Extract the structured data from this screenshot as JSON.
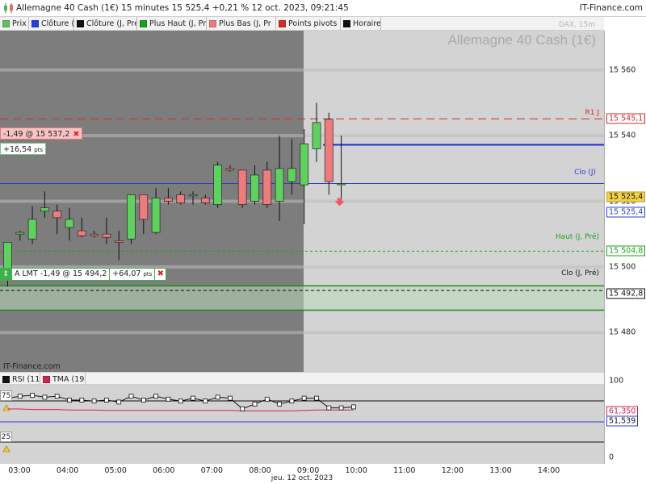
{
  "header": {
    "title": "Allemagne 40 Cash (1€) 15 minutes 15 525,4 +0,21 % 12 oct. 2023, 09:21:45",
    "brand": "IT-Finance.com"
  },
  "legend": {
    "items": [
      {
        "label": "Prix",
        "color": "#5fc15f"
      },
      {
        "label": "Clôture (J",
        "color": "#2b3ed8"
      },
      {
        "label": "Clôture (J, Pré",
        "color": "#111111"
      },
      {
        "label": "Plus Haut (J, Pr",
        "color": "#1aa31a"
      },
      {
        "label": "Plus Bas (J, Pr",
        "color": "#ef7c7c"
      },
      {
        "label": "Points pivots (",
        "color": "#d12b2b"
      },
      {
        "label": "Horaires",
        "color": "#111111"
      }
    ]
  },
  "watermark": {
    "instrument": "Allemagne 40 Cash (1€)",
    "sub": "DAX, 15m"
  },
  "position": {
    "label": "-1,49 @ 15 537,2",
    "pnl_value": "+16,54",
    "pnl_unit": "pts",
    "close": "✖"
  },
  "order": {
    "handle": "⇕",
    "label": "A LMT -1,49 @ 15 494,2",
    "pnl_value": "+64,07",
    "pnl_unit": "pts",
    "close": "✖"
  },
  "level_labels": {
    "r1": "R1 J",
    "clo": "Clo (J)",
    "haut": "Haut (J, Pré)",
    "clo_pre": "Clo (J, Pré)"
  },
  "site_label": "IT-Finance.com",
  "indicator_legend": {
    "items": [
      {
        "label": "RSI (11",
        "color": "#111111"
      },
      {
        "label": "TMA (19)",
        "color": "#d0244a"
      }
    ]
  },
  "indicator": {
    "upper_level": "75",
    "lower_level": "25",
    "rsi_last": "51,539",
    "tma_last": "61,350"
  },
  "y_axis_main": {
    "ticks": [
      "15 560",
      "15 540",
      "15 520",
      "15 500",
      "15 480"
    ],
    "labels": {
      "r1": "15 545,1",
      "last": "15 525,4",
      "clo": "15 525,4",
      "haut": "15 504,8",
      "clo_pre": "15 492,8"
    },
    "colors": {
      "r1": "#d12b2b",
      "last": "#f4d34a",
      "clo": "#2b3ed8",
      "haut": "#1aa31a",
      "clo_pre": "#111111"
    }
  },
  "y_axis_ind": {
    "ticks": [
      "100",
      "0"
    ]
  },
  "x_axis": {
    "ticks": [
      "03:00",
      "04:00",
      "05:00",
      "06:00",
      "07:00",
      "08:00",
      "09:00",
      "10:00",
      "11:00",
      "12:00",
      "13:00",
      "14:00"
    ],
    "date": "jeu. 12 oct. 2023"
  },
  "chart_data": {
    "type": "candlestick",
    "interval": "15 minutes",
    "y_range": [
      15468,
      15572
    ],
    "candles": [
      {
        "t": "02:45",
        "o": 15496.0,
        "h": 15507.0,
        "l": 15494.0,
        "c": 15507.5
      },
      {
        "t": "03:00",
        "o": 15510.0,
        "h": 15511.0,
        "l": 15508.0,
        "c": 15510.5
      },
      {
        "t": "03:15",
        "o": 15508.5,
        "h": 15518.5,
        "l": 15507.0,
        "c": 15514.5
      },
      {
        "t": "03:30",
        "o": 15517.0,
        "h": 15523.0,
        "l": 15515.0,
        "c": 15518.0
      },
      {
        "t": "03:45",
        "o": 15517.0,
        "h": 15519.0,
        "l": 15510.0,
        "c": 15515.0
      },
      {
        "t": "04:00",
        "o": 15512.0,
        "h": 15518.0,
        "l": 15508.0,
        "c": 15514.5
      },
      {
        "t": "04:15",
        "o": 15511.0,
        "h": 15515.0,
        "l": 15509.0,
        "c": 15509.5
      },
      {
        "t": "04:30",
        "o": 15510.0,
        "h": 15511.0,
        "l": 15509.0,
        "c": 15509.5
      },
      {
        "t": "04:45",
        "o": 15510.0,
        "h": 15515.0,
        "l": 15507.0,
        "c": 15509.0
      },
      {
        "t": "05:00",
        "o": 15508.0,
        "h": 15511.0,
        "l": 15502.0,
        "c": 15507.5
      },
      {
        "t": "05:15",
        "o": 15508.5,
        "h": 15522.0,
        "l": 15507.0,
        "c": 15522.0
      },
      {
        "t": "05:30",
        "o": 15522.0,
        "h": 15522.0,
        "l": 15510.0,
        "c": 15514.5
      },
      {
        "t": "05:45",
        "o": 15510.5,
        "h": 15524.0,
        "l": 15510.0,
        "c": 15521.0
      },
      {
        "t": "06:00",
        "o": 15521.0,
        "h": 15524.0,
        "l": 15519.0,
        "c": 15520.0
      },
      {
        "t": "06:15",
        "o": 15522.0,
        "h": 15523.0,
        "l": 15519.0,
        "c": 15519.5
      },
      {
        "t": "06:30",
        "o": 15522.0,
        "h": 15523.0,
        "l": 15519.0,
        "c": 15522.0
      },
      {
        "t": "06:45",
        "o": 15521.0,
        "h": 15522.0,
        "l": 15519.0,
        "c": 15519.5
      },
      {
        "t": "07:00",
        "o": 15519.0,
        "h": 15532.0,
        "l": 15518.0,
        "c": 15531.0
      },
      {
        "t": "07:15",
        "o": 15530.0,
        "h": 15531.0,
        "l": 15529.0,
        "c": 15529.5
      },
      {
        "t": "07:30",
        "o": 15529.5,
        "h": 15529.5,
        "l": 15518.0,
        "c": 15519.0
      },
      {
        "t": "07:45",
        "o": 15520.0,
        "h": 15531.0,
        "l": 15519.0,
        "c": 15528.0
      },
      {
        "t": "08:00",
        "o": 15529.5,
        "h": 15532.0,
        "l": 15518.0,
        "c": 15519.0
      },
      {
        "t": "08:15",
        "o": 15520.0,
        "h": 15540.0,
        "l": 15514.0,
        "c": 15530.0
      },
      {
        "t": "08:30",
        "o": 15526.0,
        "h": 15539.0,
        "l": 15522.0,
        "c": 15530.0
      },
      {
        "t": "08:45",
        "o": 15525.0,
        "h": 15542.0,
        "l": 15513.0,
        "c": 15537.5
      },
      {
        "t": "09:00",
        "o": 15536.0,
        "h": 15550.0,
        "l": 15532.0,
        "c": 15544.0
      },
      {
        "t": "09:15",
        "o": 15545.0,
        "h": 15547.0,
        "l": 15522.0,
        "c": 15526.0
      },
      {
        "t": "09:30",
        "o": 15525.4,
        "h": 15540.0,
        "l": 15520.5,
        "c": 15525.4
      }
    ],
    "levels": {
      "r1": 15545.1,
      "current": 15537.2,
      "clo": 15525.4,
      "haut_pre": 15504.8,
      "clo_pre": 15492.8,
      "order": 15494.2
    },
    "rsi": [
      59,
      61,
      62,
      60,
      61,
      57,
      57,
      56,
      57,
      55,
      61,
      57,
      61,
      58,
      56,
      59,
      56,
      60,
      59,
      48,
      53,
      58,
      53,
      56,
      59,
      59,
      49,
      49,
      50
    ],
    "tma": [
      63,
      63,
      62,
      62,
      62,
      61,
      61,
      61,
      60,
      60,
      60,
      60,
      60,
      60,
      60,
      60,
      60,
      60,
      60,
      59,
      59,
      59,
      59,
      59,
      60,
      61,
      61,
      61,
      61
    ],
    "rsi_range": [
      0,
      100
    ],
    "rsi_levels": [
      75,
      25
    ]
  }
}
